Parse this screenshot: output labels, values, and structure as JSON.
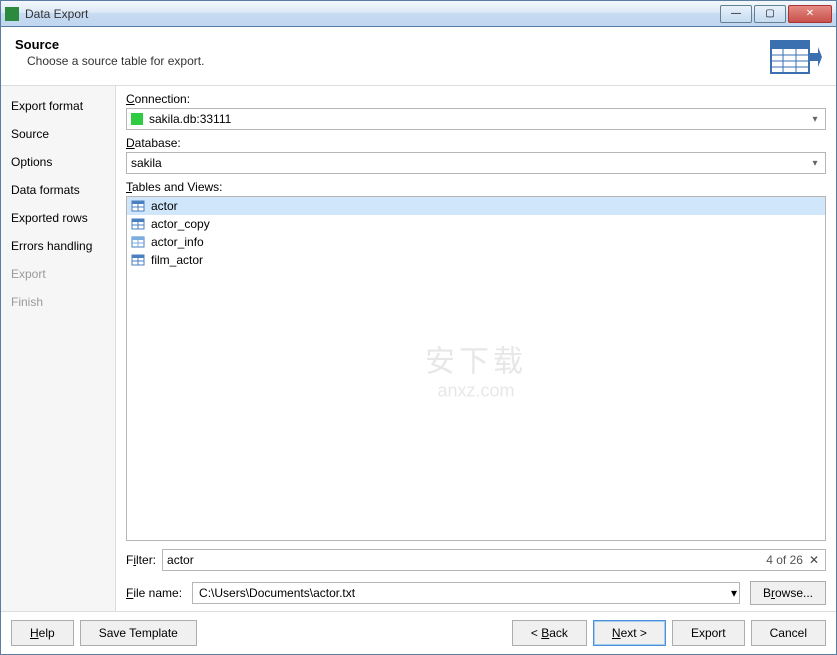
{
  "window": {
    "title": "Data Export"
  },
  "header": {
    "title": "Source",
    "subtitle": "Choose a source table for export."
  },
  "sidebar": {
    "items": [
      {
        "label": "Export format",
        "disabled": false
      },
      {
        "label": "Source",
        "disabled": false
      },
      {
        "label": "Options",
        "disabled": false
      },
      {
        "label": "Data formats",
        "disabled": false
      },
      {
        "label": "Exported rows",
        "disabled": false
      },
      {
        "label": "Errors handling",
        "disabled": false
      },
      {
        "label": "Export",
        "disabled": true
      },
      {
        "label": "Finish",
        "disabled": true
      }
    ]
  },
  "form": {
    "connection_label": "Connection:",
    "connection_value": "sakila.db:33111",
    "database_label": "Database:",
    "database_value": "sakila",
    "tables_label": "Tables and Views:",
    "tables": [
      {
        "name": "actor",
        "type": "table",
        "selected": true
      },
      {
        "name": "actor_copy",
        "type": "table",
        "selected": false
      },
      {
        "name": "actor_info",
        "type": "view",
        "selected": false
      },
      {
        "name": "film_actor",
        "type": "table",
        "selected": false
      }
    ],
    "filter_label": "Filter:",
    "filter_value": "actor",
    "filter_count": "4 of 26",
    "filename_label": "File name:",
    "filename_value": "C:\\Users\\Documents\\actor.txt",
    "browse_label": "Browse..."
  },
  "footer": {
    "help": "Help",
    "save_template": "Save Template",
    "back": "< Back",
    "next": "Next >",
    "export": "Export",
    "cancel": "Cancel"
  },
  "watermark": {
    "line1": "安下载",
    "line2": "anxz.com"
  }
}
